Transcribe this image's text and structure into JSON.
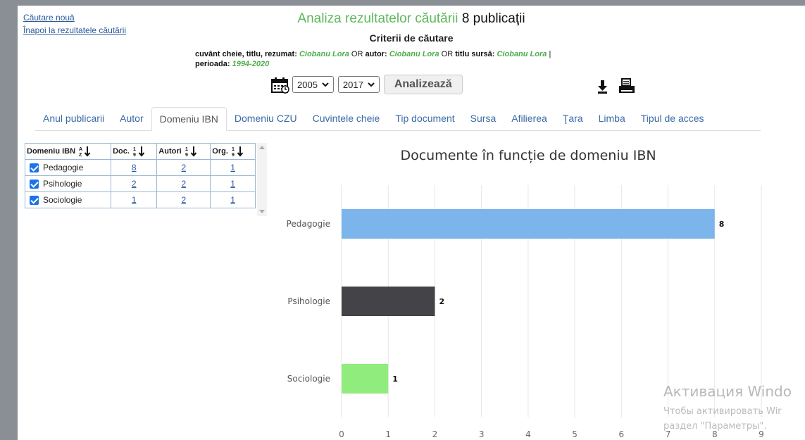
{
  "links": {
    "new_search": "Căutare nouă",
    "back": "Înapoi la rezultatele căutării"
  },
  "header": {
    "title_green": "Analiza rezultatelor căutării",
    "title_count": "8 publicaţii",
    "subtitle": "Criterii de căutare",
    "criteria": {
      "k1": "cuvânt cheie, titlu, rezumat:",
      "v1": "Ciobanu Lora",
      "op1": "OR",
      "k2": "autor:",
      "v2": "Ciobanu Lora",
      "op2": "OR",
      "k3": "titlu sursă:",
      "v3": "Ciobanu Lora",
      "sep": "|",
      "k4": "perioada:",
      "v4": "1994-2020"
    }
  },
  "controls": {
    "year_from": "2005",
    "year_to": "2017",
    "analyze_label": "Analizează",
    "icons": [
      "calendar-icon",
      "download-icon",
      "print-icon"
    ]
  },
  "tabs": [
    "Anul publicarii",
    "Autor",
    "Domeniu IBN",
    "Domeniu CZU",
    "Cuvintele cheie",
    "Tip document",
    "Sursa",
    "Afilierea",
    "Ţara",
    "Limba",
    "Tipul de acces"
  ],
  "active_tab": "Domeniu IBN",
  "table": {
    "headers": [
      "Domeniu IBN",
      "Doc.",
      "Autori",
      "Org."
    ],
    "rows": [
      {
        "name": "Pedagogie",
        "doc": "8",
        "autori": "2",
        "org": "1"
      },
      {
        "name": "Psihologie",
        "doc": "2",
        "autori": "2",
        "org": "1"
      },
      {
        "name": "Sociologie",
        "doc": "1",
        "autori": "2",
        "org": "1"
      }
    ]
  },
  "chart_data": {
    "type": "bar",
    "orientation": "horizontal",
    "title": "Documente în funcție de domeniu IBN",
    "categories": [
      "Pedagogie",
      "Psihologie",
      "Sociologie"
    ],
    "values": [
      8,
      2,
      1
    ],
    "colors": [
      "#7cb5ec",
      "#434348",
      "#90ed7d"
    ],
    "xlim": [
      0,
      9
    ],
    "ticks": [
      0,
      1,
      2,
      3,
      4,
      5,
      6,
      7,
      8,
      9
    ],
    "grid": true
  },
  "watermark": {
    "line1": "Активация Windo",
    "line2": "Чтобы активировать Wir",
    "line3": "раздел \"Параметры\"."
  }
}
